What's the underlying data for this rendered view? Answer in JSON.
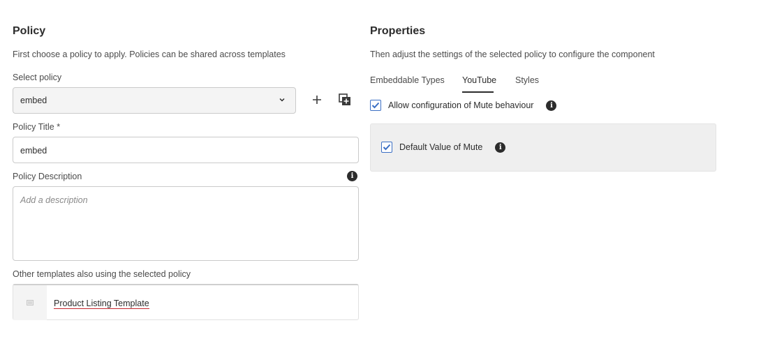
{
  "policy": {
    "title": "Policy",
    "description": "First choose a policy to apply. Policies can be shared across templates",
    "select_label": "Select policy",
    "select_value": "embed",
    "title_label": "Policy Title *",
    "title_value": "embed",
    "desc_label": "Policy Description",
    "desc_placeholder": "Add a description",
    "other_label": "Other templates also using the selected policy",
    "templates": [
      {
        "name": "Product Listing Template"
      }
    ]
  },
  "properties": {
    "title": "Properties",
    "description": "Then adjust the settings of the selected policy to configure the component",
    "tabs": [
      {
        "label": "Embeddable Types",
        "active": false
      },
      {
        "label": "YouTube",
        "active": true
      },
      {
        "label": "Styles",
        "active": false
      }
    ],
    "allow_mute_label": "Allow configuration of Mute behaviour",
    "allow_mute_checked": true,
    "default_mute_label": "Default Value of Mute",
    "default_mute_checked": true
  },
  "colors": {
    "checkbox_accent": "#3b6fc4",
    "link_underline": "#c4262e"
  }
}
